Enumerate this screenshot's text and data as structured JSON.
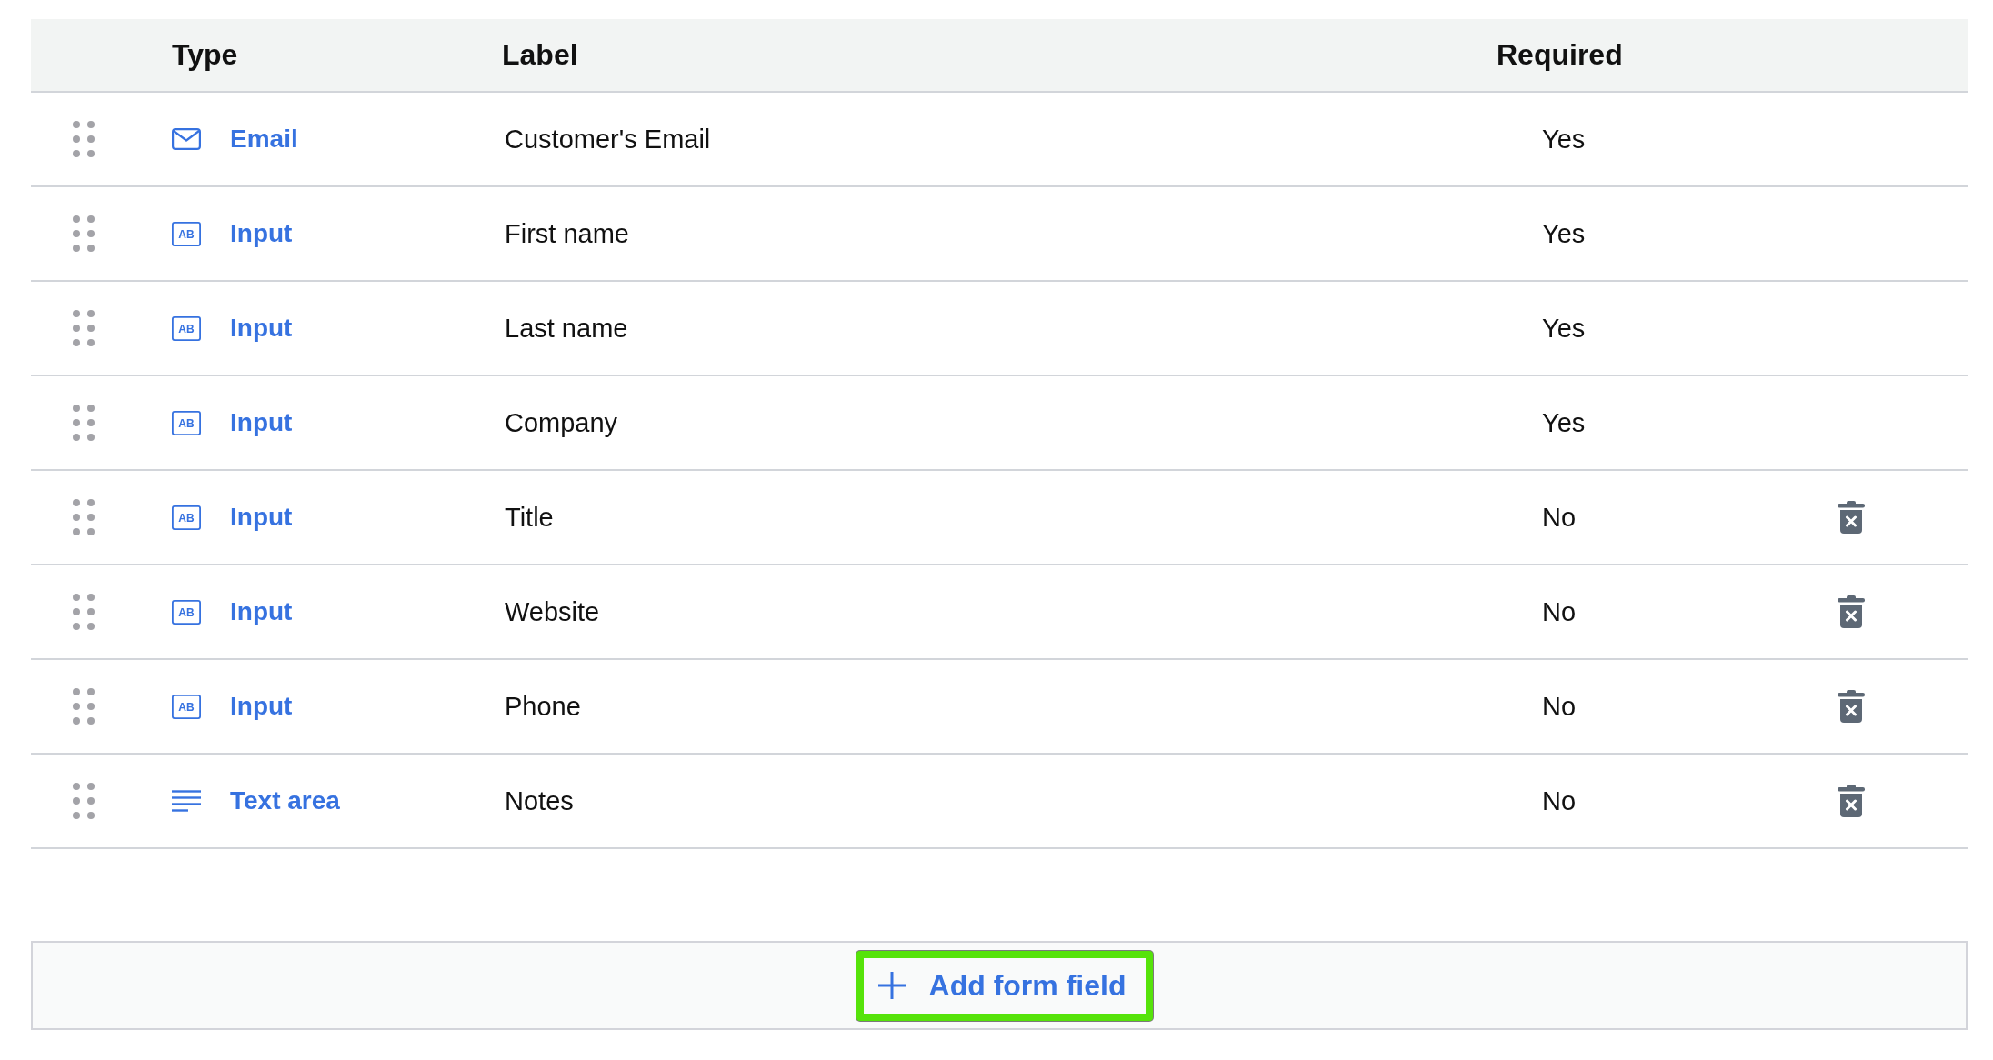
{
  "table": {
    "columns": [
      "Type",
      "Label",
      "Required"
    ],
    "rows": [
      {
        "kind": "email",
        "type": "Email",
        "label": "Customer's Email",
        "required": "Yes",
        "deletable": false
      },
      {
        "kind": "input",
        "icon_text": "AB",
        "type": "Input",
        "label": "First name",
        "required": "Yes",
        "deletable": false
      },
      {
        "kind": "input",
        "icon_text": "AB",
        "type": "Input",
        "label": "Last name",
        "required": "Yes",
        "deletable": false
      },
      {
        "kind": "input",
        "icon_text": "AB",
        "type": "Input",
        "label": "Company",
        "required": "Yes",
        "deletable": false
      },
      {
        "kind": "input",
        "icon_text": "AB",
        "type": "Input",
        "label": "Title",
        "required": "No",
        "deletable": true
      },
      {
        "kind": "input",
        "icon_text": "AB",
        "type": "Input",
        "label": "Website",
        "required": "No",
        "deletable": true
      },
      {
        "kind": "input",
        "icon_text": "AB",
        "type": "Input",
        "label": "Phone",
        "required": "No",
        "deletable": true
      },
      {
        "kind": "textarea",
        "type": "Text area",
        "label": "Notes",
        "required": "No",
        "deletable": true
      }
    ]
  },
  "add_button": {
    "label": "Add form field",
    "focused": true
  }
}
